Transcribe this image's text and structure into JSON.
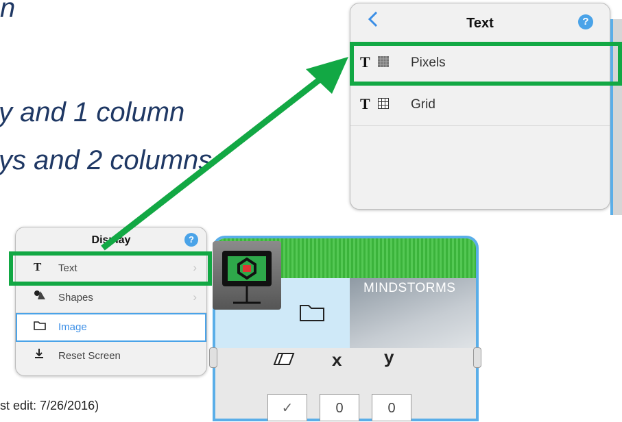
{
  "slide": {
    "title_fragment": "n",
    "bullet1": "y and 1 column",
    "bullet2": "ys and 2 columns",
    "footnote": "st edit: 7/26/2016)"
  },
  "text_panel": {
    "back_icon": "chevron-left-icon",
    "title": "Text",
    "help_label": "?",
    "items": [
      {
        "label": "Pixels",
        "icon_letter": "T",
        "icon": "pixels-grid-icon"
      },
      {
        "label": "Grid",
        "icon_letter": "T",
        "icon": "grid-icon"
      }
    ]
  },
  "display_panel": {
    "title": "Display",
    "help_label": "?",
    "items": [
      {
        "label": "Text",
        "icon": "text-icon",
        "chevron": "›"
      },
      {
        "label": "Shapes",
        "icon": "shapes-icon",
        "chevron": "›"
      },
      {
        "label": "Image",
        "icon": "folder-icon",
        "selected": true
      },
      {
        "label": "Reset Screen",
        "icon": "download-icon"
      }
    ]
  },
  "block": {
    "brand": "MINDSTORMS",
    "params": [
      {
        "icon": "eraser-icon",
        "value": "✓"
      },
      {
        "icon": "x",
        "value": "0"
      },
      {
        "icon": "y",
        "value": "0"
      }
    ]
  },
  "colors": {
    "highlight_green": "#12a844",
    "help_blue": "#4aa3e8",
    "block_border": "#5aaee8",
    "slide_text": "#1f3864"
  }
}
